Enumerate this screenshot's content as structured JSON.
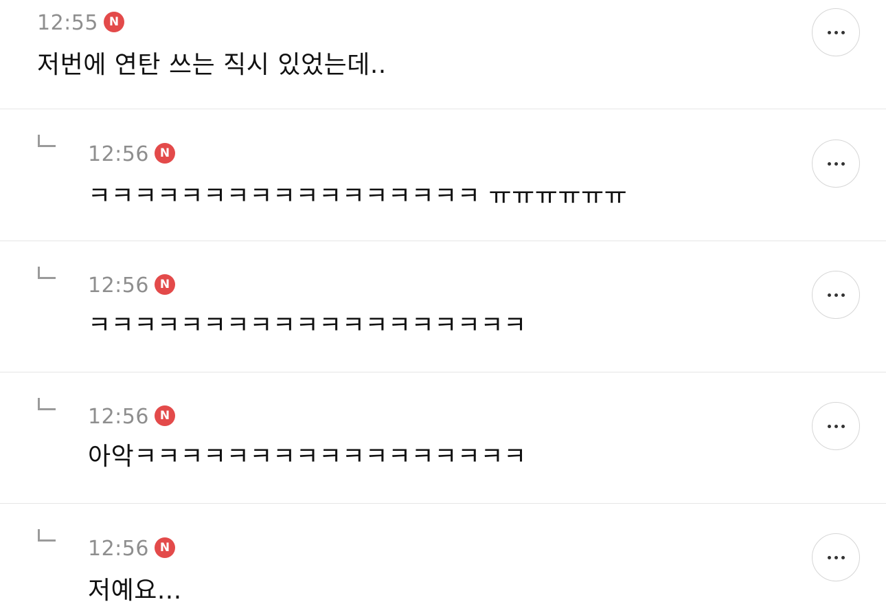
{
  "comments": [
    {
      "time": "12:55",
      "badge": "N",
      "text": "저번에 연탄 쓰는 직시 있었는데..",
      "is_reply": false
    },
    {
      "time": "12:56",
      "badge": "N",
      "text": "ㅋㅋㅋㅋㅋㅋㅋㅋㅋㅋㅋㅋㅋㅋㅋㅋㅋ ㅠㅠㅠㅠㅠㅠ",
      "is_reply": true
    },
    {
      "time": "12:56",
      "badge": "N",
      "text": "ㅋㅋㅋㅋㅋㅋㅋㅋㅋㅋㅋㅋㅋㅋㅋㅋㅋㅋㅋ",
      "is_reply": true
    },
    {
      "time": "12:56",
      "badge": "N",
      "text": "아악ㅋㅋㅋㅋㅋㅋㅋㅋㅋㅋㅋㅋㅋㅋㅋㅋㅋ",
      "is_reply": true
    },
    {
      "time": "12:56",
      "badge": "N",
      "text": "저예요...",
      "is_reply": true
    }
  ],
  "colors": {
    "badge": "#e34a4a",
    "time": "#8e8e8e",
    "divider": "#e6e6e6"
  },
  "icons": {
    "reply": "reply-arrow-icon",
    "more": "more-options-icon",
    "badge": "new-badge-icon"
  }
}
